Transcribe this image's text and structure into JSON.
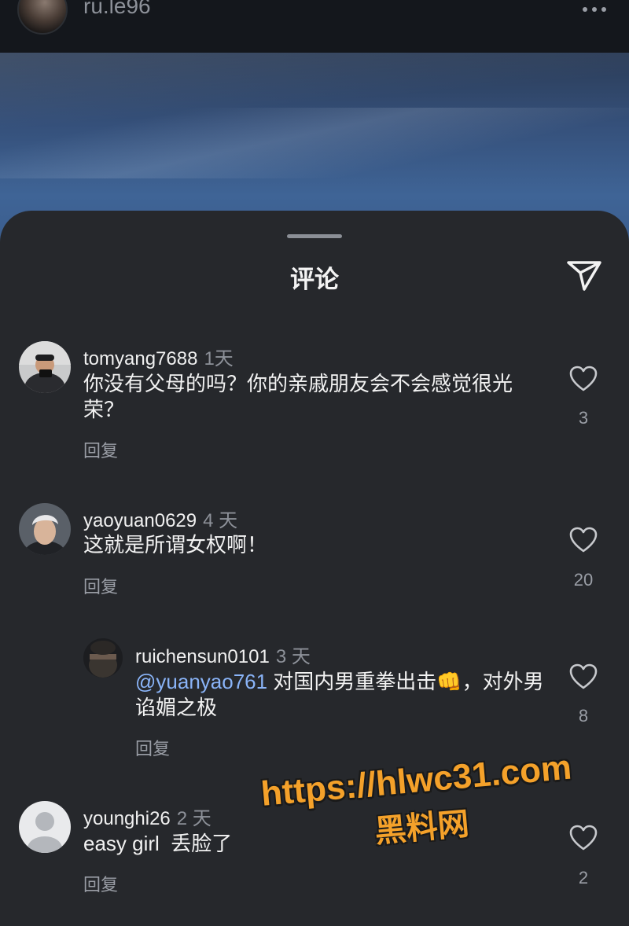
{
  "header": {
    "username": "ru.le96",
    "more_icon": "more-horizontal-icon"
  },
  "sheet": {
    "title": "评论",
    "share_icon": "send-icon"
  },
  "comments": [
    {
      "username": "tomyang7688",
      "time": "1天",
      "text": "你没有父母的吗？你的亲戚朋友会不会感觉很光荣？",
      "reply": "回复",
      "likes": "3"
    },
    {
      "username": "yaoyuan0629",
      "time": "4 天",
      "text": "这就是所谓女权啊！",
      "reply": "回复",
      "likes": "20"
    },
    {
      "username": "ruichensun0101",
      "time": "3 天",
      "mention": "@yuanyao761",
      "text": " 对国内男重拳出击👊，对外男谄媚之极",
      "reply": "回复",
      "likes": "8"
    },
    {
      "username": "younghi26",
      "time": "2 天",
      "text": "easy girl  丢脸了",
      "reply": "回复",
      "likes": "2"
    }
  ],
  "watermark": {
    "line1": "https://hlwc31.com",
    "line2": "黑料网"
  }
}
